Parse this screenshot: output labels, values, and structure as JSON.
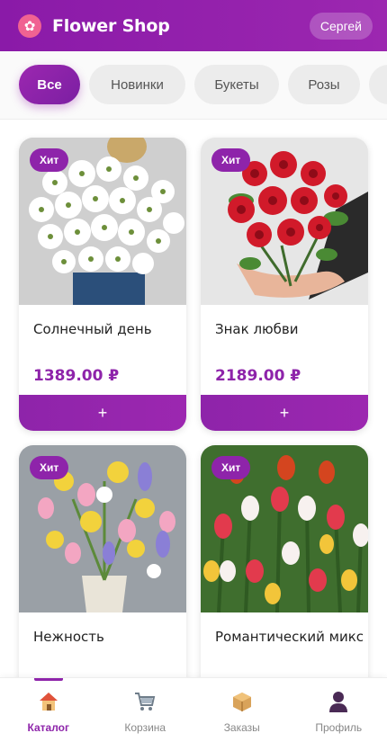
{
  "header": {
    "logo_icon": "flower-icon",
    "title": "Flower Shop",
    "user": "Сергей"
  },
  "filters": [
    {
      "label": "Все",
      "active": true
    },
    {
      "label": "Новинки",
      "active": false
    },
    {
      "label": "Букеты",
      "active": false
    },
    {
      "label": "Розы",
      "active": false
    },
    {
      "label": "",
      "active": false
    }
  ],
  "products": [
    {
      "name": "Солнечный день",
      "price": "1389.00 ₽",
      "badge": "Хит",
      "add_label": "+",
      "image": "white-chrysanthemum-bouquet"
    },
    {
      "name": "Знак любви",
      "price": "2189.00 ₽",
      "badge": "Хит",
      "add_label": "+",
      "image": "red-roses-bouquet"
    },
    {
      "name": "Нежность",
      "price": "",
      "badge": "Хит",
      "add_label": "",
      "image": "spring-tulips-daffodils-vase"
    },
    {
      "name": "Романтический микс",
      "price": "",
      "badge": "Хит",
      "add_label": "",
      "image": "mixed-tulips-field"
    }
  ],
  "nav": [
    {
      "label": "Каталог",
      "icon": "home-icon",
      "active": true
    },
    {
      "label": "Корзина",
      "icon": "cart-icon",
      "active": false
    },
    {
      "label": "Заказы",
      "icon": "box-icon",
      "active": false
    },
    {
      "label": "Профиль",
      "icon": "user-icon",
      "active": false
    }
  ],
  "colors": {
    "primary": "#8e24aa",
    "accent": "#9c27b0"
  }
}
